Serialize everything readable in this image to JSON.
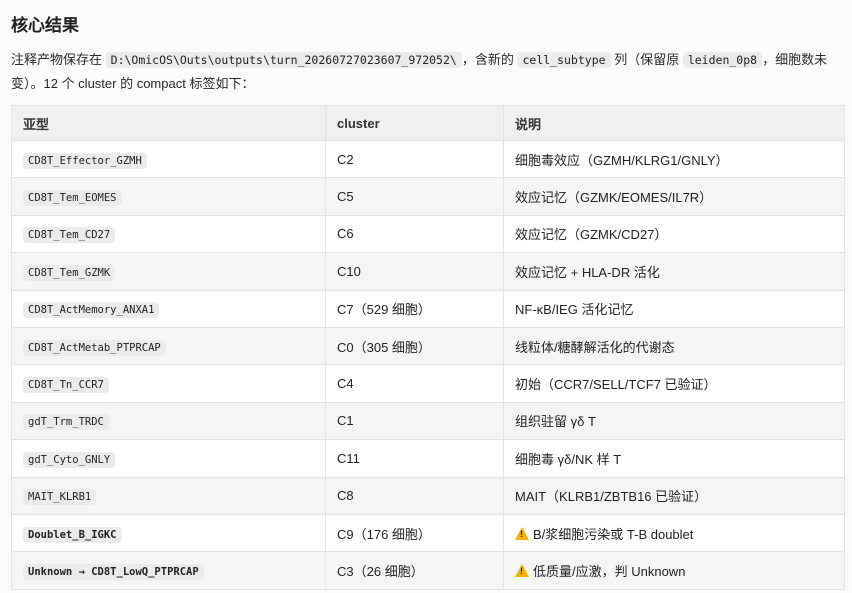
{
  "heading": "核心结果",
  "intro": {
    "t1": "注释产物保存在",
    "path": "D:\\OmicOS\\Outs\\outputs\\turn_20260727023607_972052\\",
    "t2": "，含新的",
    "col": "cell_subtype",
    "t3": "列（保留原",
    "orig": "leiden_0p8",
    "t4": "，细胞数未变）。12 个 cluster 的 compact 标签如下："
  },
  "table": {
    "headers": [
      "亚型",
      "cluster",
      "说明"
    ],
    "rows": [
      {
        "subtype": "CD8T_Effector_GZMH",
        "cluster": "C2",
        "desc": "细胞毒效应（GZMH/KLRG1/GNLY）",
        "bold": false,
        "warn": false
      },
      {
        "subtype": "CD8T_Tem_EOMES",
        "cluster": "C5",
        "desc": "效应记忆（GZMK/EOMES/IL7R）",
        "bold": false,
        "warn": false
      },
      {
        "subtype": "CD8T_Tem_CD27",
        "cluster": "C6",
        "desc": "效应记忆（GZMK/CD27）",
        "bold": false,
        "warn": false
      },
      {
        "subtype": "CD8T_Tem_GZMK",
        "cluster": "C10",
        "desc": "效应记忆 + HLA-DR 活化",
        "bold": false,
        "warn": false
      },
      {
        "subtype": "CD8T_ActMemory_ANXA1",
        "cluster": "C7（529 细胞）",
        "desc": "NF-κB/IEG 活化记忆",
        "bold": false,
        "warn": false
      },
      {
        "subtype": "CD8T_ActMetab_PTPRCAP",
        "cluster": "C0（305 细胞）",
        "desc": "线粒体/糖酵解活化的代谢态",
        "bold": false,
        "warn": false
      },
      {
        "subtype": "CD8T_Tn_CCR7",
        "cluster": "C4",
        "desc": "初始（CCR7/SELL/TCF7 已验证）",
        "bold": false,
        "warn": false
      },
      {
        "subtype": "gdT_Trm_TRDC",
        "cluster": "C1",
        "desc": "组织驻留 γδ T",
        "bold": false,
        "warn": false
      },
      {
        "subtype": "gdT_Cyto_GNLY",
        "cluster": "C11",
        "desc": "细胞毒 γδ/NK 样 T",
        "bold": false,
        "warn": false
      },
      {
        "subtype": "MAIT_KLRB1",
        "cluster": "C8",
        "desc": "MAIT（KLRB1/ZBTB16 已验证）",
        "bold": false,
        "warn": false
      },
      {
        "subtype": "Doublet_B_IGKC",
        "cluster": "C9（176 细胞）",
        "desc": "B/浆细胞污染或 T-B doublet",
        "bold": true,
        "warn": true
      },
      {
        "subtype": "Unknown → CD8T_LowQ_PTPRCAP",
        "cluster": "C3（26 细胞）",
        "desc": "低质量/应激，判 Unknown",
        "bold": true,
        "warn": true
      }
    ]
  },
  "icons": {
    "warning": "warning-icon"
  },
  "colors": {
    "warning": "#f2b400"
  }
}
